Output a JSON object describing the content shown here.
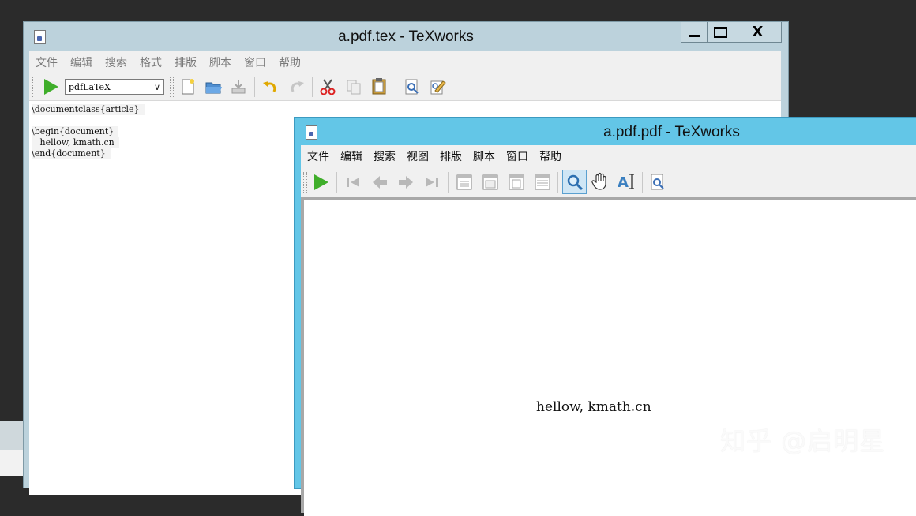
{
  "editor_window": {
    "title": "a.pdf.tex - TeXworks",
    "close_glyph": "X",
    "menu": [
      "文件",
      "编辑",
      "搜索",
      "格式",
      "排版",
      "脚本",
      "窗口",
      "帮助"
    ],
    "engine": "pdfLaTeX",
    "toolbar_icons": [
      "typeset-icon",
      "new-document-icon",
      "open-folder-icon",
      "save-icon",
      "undo-icon",
      "redo-icon",
      "cut-icon",
      "copy-icon",
      "paste-icon",
      "find-icon",
      "replace-icon"
    ],
    "source_lines": [
      "\\documentclass{article}",
      "",
      "\\begin{document}",
      "   hellow, kmath.cn",
      "\\end{document}"
    ]
  },
  "pdf_window": {
    "title": "a.pdf.pdf - TeXworks",
    "menu": [
      "文件",
      "编辑",
      "搜索",
      "视图",
      "排版",
      "脚本",
      "窗口",
      "帮助"
    ],
    "toolbar_icons": [
      "typeset-icon",
      "first-page-icon",
      "previous-page-icon",
      "next-page-icon",
      "last-page-icon",
      "single-page-icon",
      "continuous-page-icon",
      "fit-width-icon",
      "fit-window-icon",
      "magnify-icon",
      "hand-scroll-icon",
      "select-text-icon",
      "find-icon"
    ],
    "active_tool": "magnify-icon",
    "page_text": "hellow, kmath.cn"
  },
  "watermark": "知乎 @启明星",
  "colors": {
    "editor_frame": "#bcd2dc",
    "pdf_frame": "#63c6e7",
    "play_green": "#3fae2a",
    "desktop": "#2b2b2b"
  }
}
